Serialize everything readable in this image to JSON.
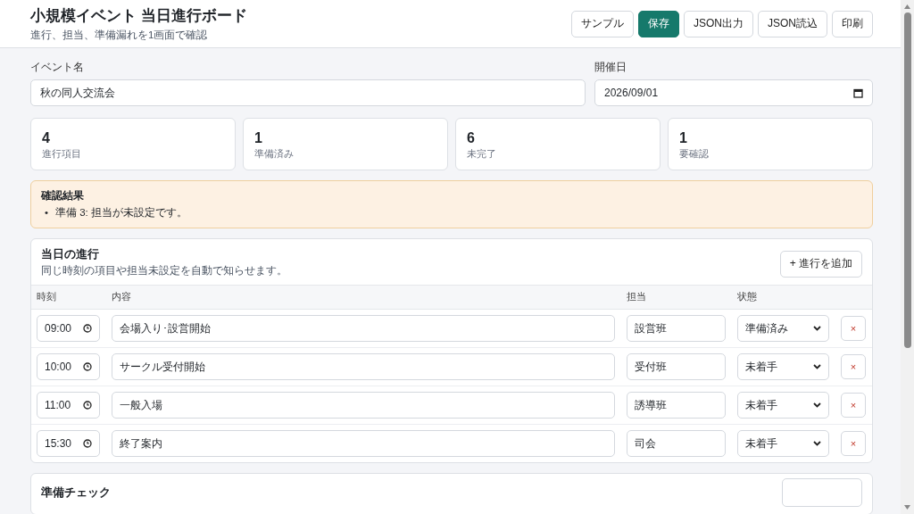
{
  "header": {
    "title": "小規模イベント 当日進行ボード",
    "subtitle": "進行、担当、準備漏れを1画面で確認",
    "buttons": [
      {
        "label": "サンプル",
        "primary": false
      },
      {
        "label": "保存",
        "primary": true
      },
      {
        "label": "JSON出力",
        "primary": false
      },
      {
        "label": "JSON読込",
        "primary": false
      },
      {
        "label": "印刷",
        "primary": false
      }
    ]
  },
  "event": {
    "name_label": "イベント名",
    "name_value": "秋の同人交流会",
    "date_label": "開催日",
    "date_value": "2026/09/01"
  },
  "stats": [
    {
      "value": "4",
      "label": "進行項目"
    },
    {
      "value": "1",
      "label": "準備済み"
    },
    {
      "value": "6",
      "label": "未完了"
    },
    {
      "value": "1",
      "label": "要確認"
    }
  ],
  "alert": {
    "title": "確認結果",
    "items": [
      {
        "bullet": "•",
        "text": "準備 3: 担当が未設定です。"
      }
    ]
  },
  "schedule": {
    "title": "当日の進行",
    "subtitle": "同じ時刻の項目や担当未設定を自動で知らせます。",
    "add_button": "+ 進行を追加",
    "columns": [
      "時刻",
      "内容",
      "担当",
      "状態"
    ],
    "rows": [
      {
        "time": "09:00",
        "content": "会場入り･設営開始",
        "assignee": "設営班",
        "status": "準備済み",
        "delete": "×"
      },
      {
        "time": "10:00",
        "content": "サークル受付開始",
        "assignee": "受付班",
        "status": "未着手",
        "delete": "×"
      },
      {
        "time": "11:00",
        "content": "一般入場",
        "assignee": "誘導班",
        "status": "未着手",
        "delete": "×"
      },
      {
        "time": "15:30",
        "content": "終了案内",
        "assignee": "司会",
        "status": "未着手",
        "delete": "×"
      }
    ]
  },
  "checklist": {
    "title": "準備チェック"
  }
}
